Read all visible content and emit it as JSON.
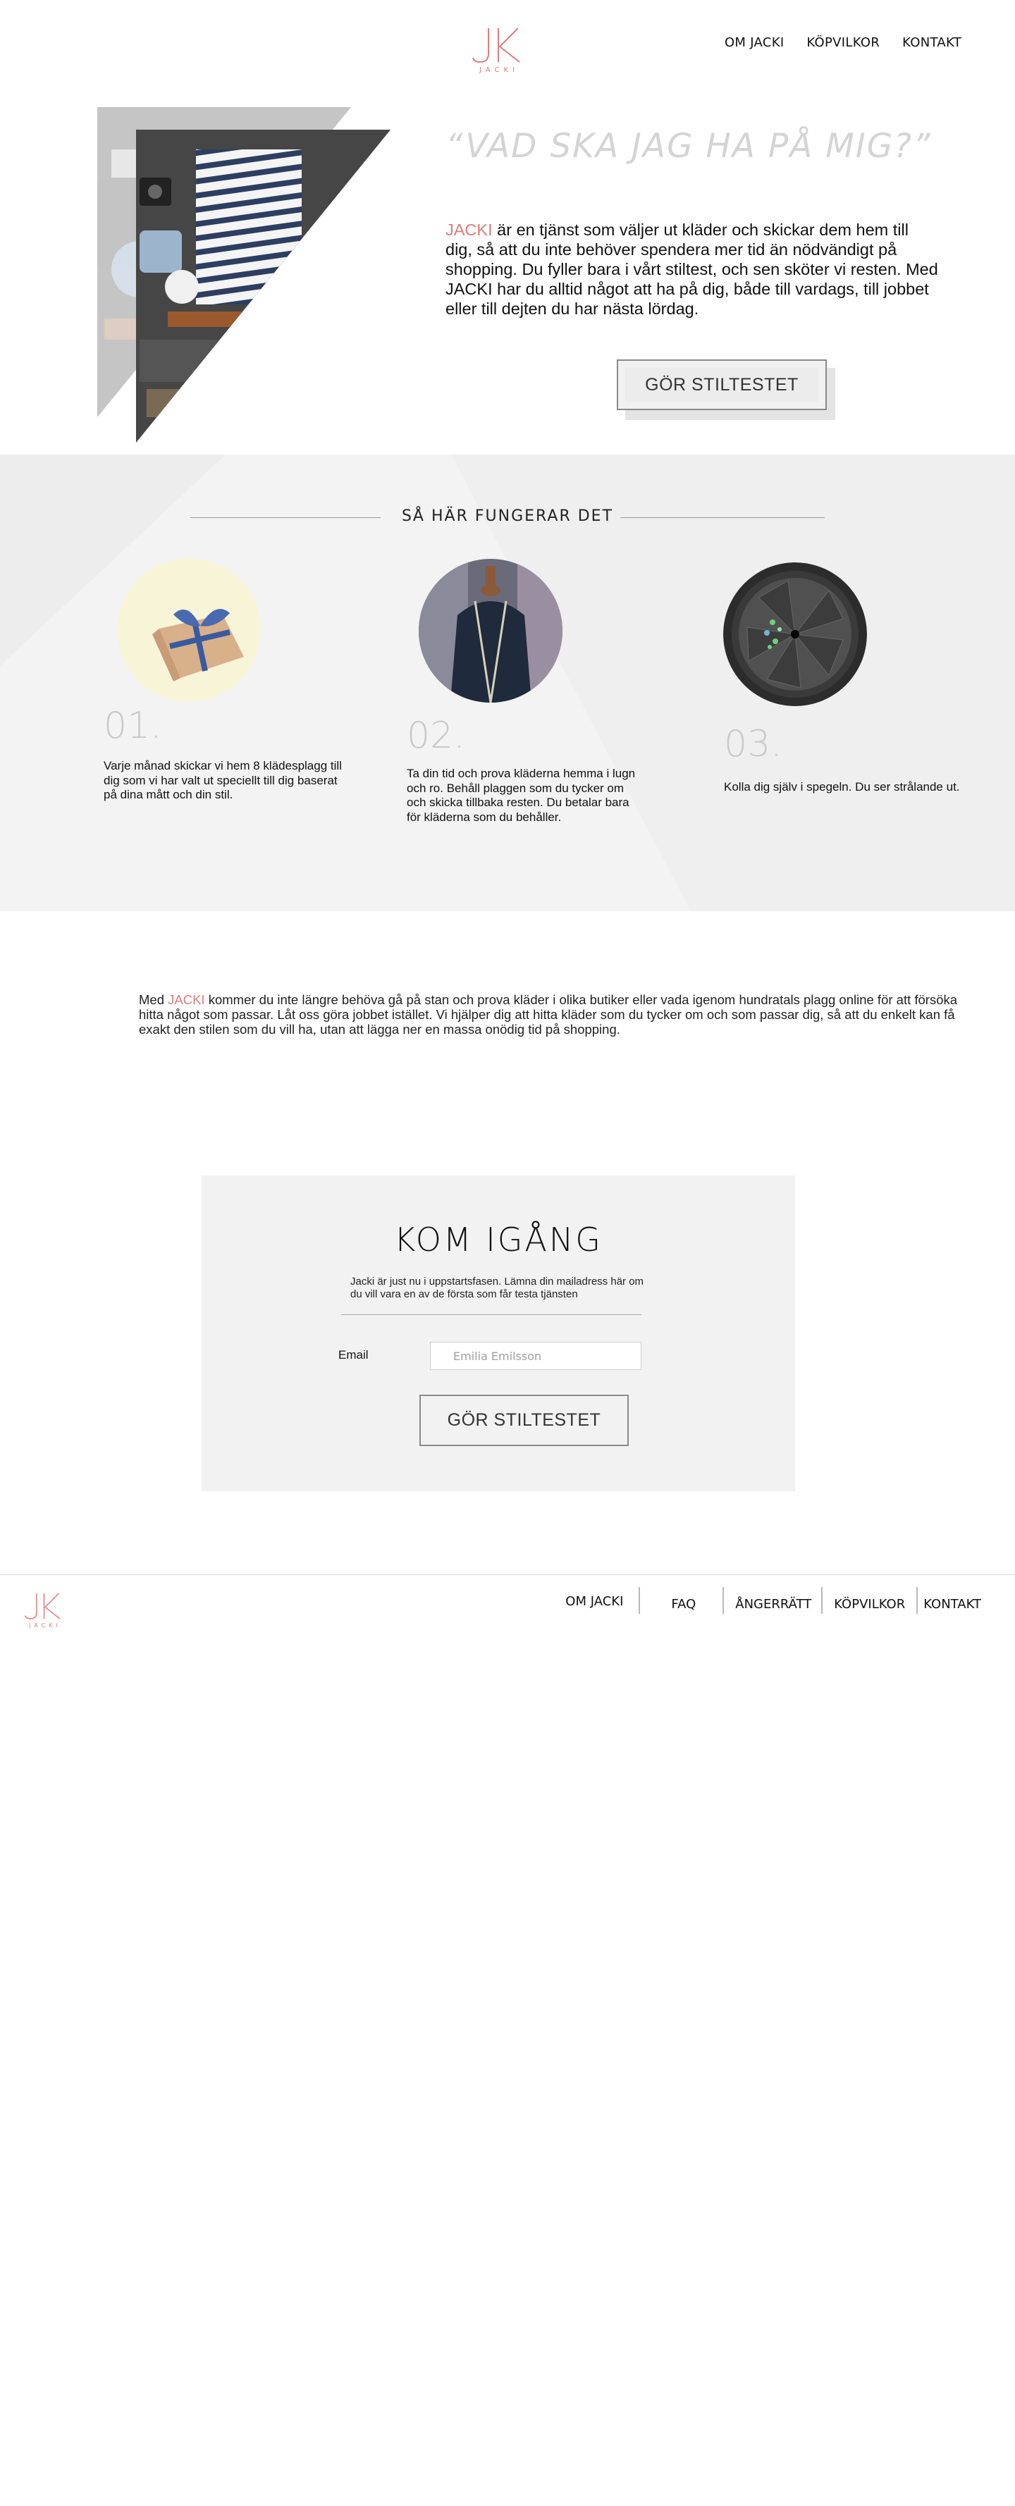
{
  "header": {
    "logo_monogram": "JK",
    "logo_word": "JACKI",
    "nav": [
      "OM JACKI",
      "KÖPVILKOR",
      "KONTAKT"
    ]
  },
  "hero": {
    "quote": "“VAD SKA JAG HA PÅ MIG?”",
    "brand": "JACKI",
    "text": " är en tjänst som väljer ut kläder och skickar dem hem till dig, så att du inte behöver spendera mer tid än nödvändigt på shopping. Du fyller bara i vårt stiltest, och sen sköter vi resten. Med JACKI har du alltid något att ha på dig, både till vardags, till jobbet eller till dejten du har nästa lördag.",
    "button": "GÖR STILTESTET"
  },
  "how": {
    "title": "SÅ HÄR FUNGERAR DET",
    "steps": [
      {
        "num": "01.",
        "text": "Varje månad skickar vi hem 8 klädesplagg till dig som vi har valt ut speciellt till dig baserat på dina mått och din stil."
      },
      {
        "num": "02.",
        "text": "Ta din tid och prova kläderna hemma i lugn och ro. Behåll plaggen som du tycker om och skicka tillbaka resten. Du betalar bara för kläderna som du behåller."
      },
      {
        "num": "03.",
        "text": "Kolla dig själv i spegeln. Du ser strålande ut."
      }
    ]
  },
  "intro": {
    "pre": "Med ",
    "brand": "JACKI",
    "text": " kommer du inte längre behöva gå på stan och prova kläder i olika butiker eller vada igenom hundratals plagg online för att försöka hitta något som passar. Låt oss göra jobbet istället. Vi hjälper dig att hitta kläder som du tycker om och som passar dig, så att du enkelt kan få exakt den stilen som du vill ha, utan att lägga ner en massa onödig tid på shopping."
  },
  "signup": {
    "title": "KOM IGÅNG",
    "desc": "Jacki är just nu i uppstartsfasen. Lämna din mailadress här om du vill vara en av de första som får testa tjänsten",
    "email_label": "Email",
    "email_placeholder": "Emilia Emilsson",
    "button": "GÖR STILTESTET"
  },
  "footer": {
    "logo_monogram": "JK",
    "logo_word": "JACKI",
    "nav": [
      "OM JACKI",
      "FAQ",
      "ÅNGERRÄTT",
      "KÖPVILKOR",
      "KONTAKT"
    ]
  },
  "colors": {
    "accent": "#e07b7b",
    "section_bg": "#efefef",
    "button_border": "#8a8a8a",
    "quote_gray": "#d4d4d4"
  }
}
